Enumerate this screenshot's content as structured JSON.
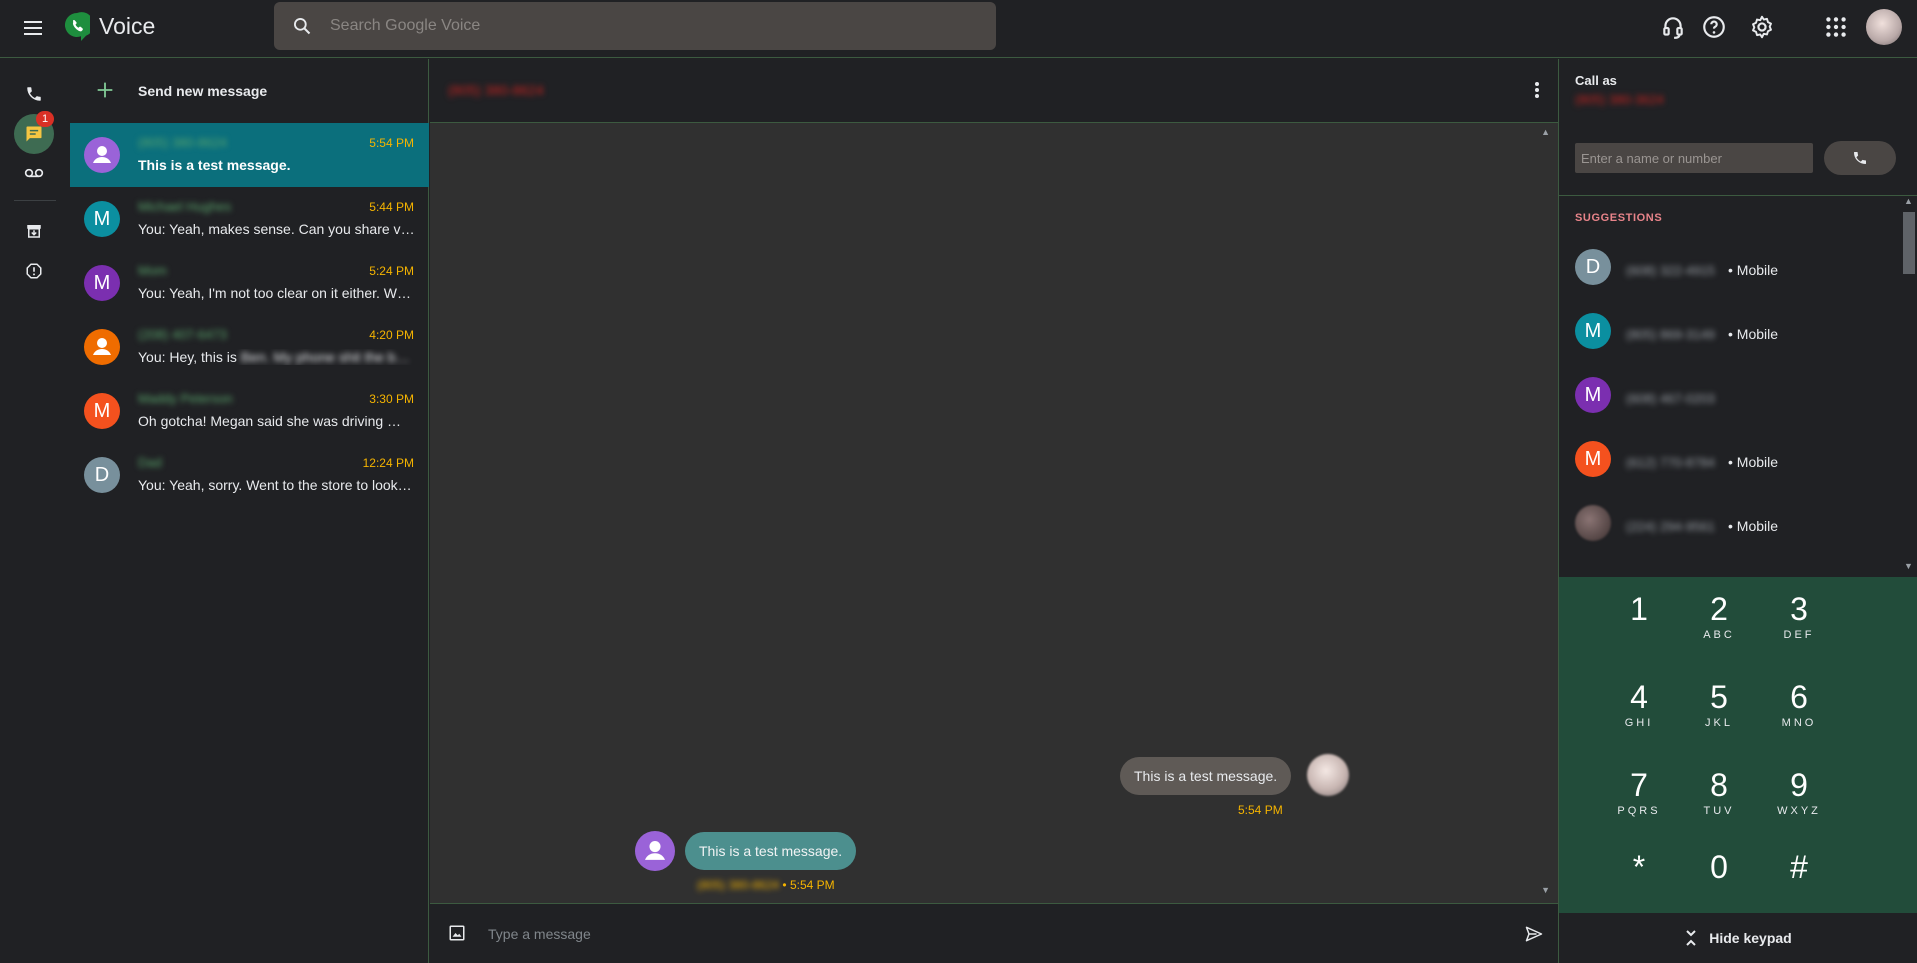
{
  "app": {
    "title": "Voice"
  },
  "search": {
    "placeholder": "Search Google Voice"
  },
  "rail": {
    "messages_badge": "1"
  },
  "list": {
    "new_message_label": "Send new message",
    "conversations": [
      {
        "name": "(805) 380-8624",
        "time": "5:54 PM",
        "preview": "This is a test message.",
        "avatar_letter": "",
        "avatar_color": "#9a63d8",
        "selected": true
      },
      {
        "name": "Michael Hughes",
        "time": "5:44 PM",
        "preview": "You: Yeah, makes sense. Can you share vi…",
        "avatar_letter": "M",
        "avatar_color": "#0b8fa0"
      },
      {
        "name": "Mom",
        "time": "5:24 PM",
        "preview": "You: Yeah, I'm not too clear on it either. W…",
        "avatar_letter": "M",
        "avatar_color": "#7b2fb0"
      },
      {
        "name": "(208) 407-6473",
        "time": "4:20 PM",
        "preview_prefix": "You: Hey, this is",
        "preview_blur": "Ben. My phone shit the b…",
        "avatar_letter": "",
        "avatar_color": "#ef6c00"
      },
      {
        "name": "Maddy Peterson",
        "time": "3:30 PM",
        "preview": "Oh gotcha! Megan said she was driving …",
        "avatar_letter": "M",
        "avatar_color": "#f4511e"
      },
      {
        "name": "Dad",
        "time": "12:24 PM",
        "preview": "You: Yeah, sorry. Went to the store to look…",
        "avatar_letter": "D",
        "avatar_color": "#78909c"
      }
    ]
  },
  "thread": {
    "contact": "(805) 380-8624",
    "outgoing": {
      "text": "This is a test message.",
      "time": "5:54 PM"
    },
    "incoming": {
      "text": "This is a test message.",
      "sender": "(805) 380-8624",
      "time": "• 5:54 PM"
    },
    "compose_placeholder": "Type a message"
  },
  "right": {
    "call_as_label": "Call as",
    "call_as_number": "(805) 380-3624",
    "input_placeholder": "Enter a name or number",
    "suggestions_label": "SUGGESTIONS",
    "suggestions": [
      {
        "letter": "D",
        "color": "#78909c",
        "number": "(608) 322-4915",
        "type": "• Mobile"
      },
      {
        "letter": "M",
        "color": "#0b8fa0",
        "number": "(805) 869-3149",
        "type": "• Mobile"
      },
      {
        "letter": "M",
        "color": "#7b2fb0",
        "number": "(608) 467-0203",
        "type": ""
      },
      {
        "letter": "M",
        "color": "#f4511e",
        "number": "(612) 770-8784",
        "type": "• Mobile"
      },
      {
        "letter": "",
        "color": "#5a4b4a",
        "number": "(224) 294-9561",
        "type": "• Mobile"
      }
    ],
    "keypad": [
      {
        "d": "1",
        "l": ""
      },
      {
        "d": "2",
        "l": "ABC"
      },
      {
        "d": "3",
        "l": "DEF"
      },
      {
        "d": "4",
        "l": "GHI"
      },
      {
        "d": "5",
        "l": "JKL"
      },
      {
        "d": "6",
        "l": "MNO"
      },
      {
        "d": "7",
        "l": "PQRS"
      },
      {
        "d": "8",
        "l": "TUV"
      },
      {
        "d": "9",
        "l": "WXYZ"
      },
      {
        "d": "*",
        "l": ""
      },
      {
        "d": "0",
        "l": ""
      },
      {
        "d": "#",
        "l": ""
      }
    ],
    "hide_keypad_label": "Hide keypad"
  },
  "colors": {
    "accent": "#0b6f7c",
    "time": "#f5b400",
    "keypad_bg": "#224c3a"
  },
  "icons": [
    "menu-icon",
    "voice-logo-icon",
    "search-icon",
    "headset-icon",
    "help-icon",
    "settings-icon",
    "apps-icon",
    "phone-icon",
    "message-icon",
    "voicemail-icon",
    "archive-icon",
    "spam-icon",
    "plus-icon",
    "more-vert-icon",
    "image-icon",
    "send-icon",
    "collapse-icon"
  ]
}
